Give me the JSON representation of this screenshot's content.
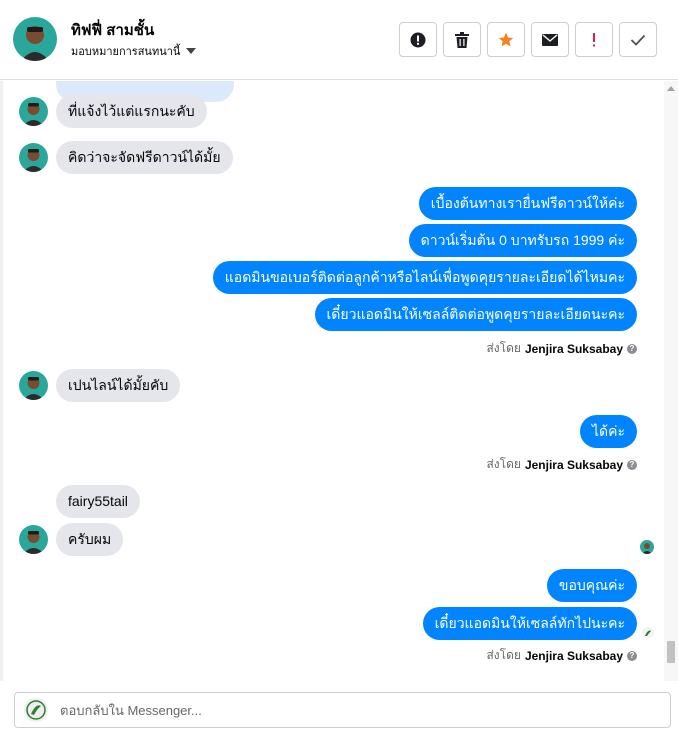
{
  "header": {
    "contact_name": "ทิฟฟี่ สามชั้น",
    "assign_label": "มอบหมายการสนทนานี้",
    "actions": [
      {
        "name": "report-spam-button",
        "icon": "exclamation-circle-icon"
      },
      {
        "name": "delete-button",
        "icon": "trash-icon"
      },
      {
        "name": "star-button",
        "icon": "star-icon"
      },
      {
        "name": "mark-unread-button",
        "icon": "envelope-icon"
      },
      {
        "name": "follow-up-button",
        "icon": "exclamation-icon"
      },
      {
        "name": "done-button",
        "icon": "check-icon"
      }
    ]
  },
  "colors": {
    "outgoing_bubble": "#0084ff",
    "incoming_bubble": "#e4e6eb",
    "star": "#f5821f",
    "follow_up": "#e41e3f"
  },
  "messages": {
    "in_1": "ที่แจ้งไว้แต่แรกนะคับ",
    "in_2": "คิดว่าจะจัดฟรีดาวน์ได้มั้ย",
    "out_1": "เบื้องต้นทางเรายื่นฟรีดาวน์ให้ค่ะ",
    "out_2": "ดาวน์เริ่มต้น 0 บาทรับรถ 1999 ค่ะ",
    "out_3": "แอดมินขอเบอร์ติดต่อลูกค้าหรือไลน์เพื่อพูดคุยรายละเอียดได้ไหมคะ",
    "out_4": "เดี๋ยวแอดมินให้เซลล์ติดต่อพูดคุยรายละเอียดนะคะ",
    "in_3": "เปนไลน์ได้มั้ยคับ",
    "out_5": "ได้ค่ะ",
    "in_4": "fairy55tail",
    "in_5": "ครับผม",
    "out_6": "ขอบคุณค่ะ",
    "out_7": "เดี๋ยวแอดมินให้เซลล์ทักไปนะคะ"
  },
  "sent_by": {
    "prefix": "ส่งโดย",
    "agent": "Jenjira Suksabay",
    "help": "?"
  },
  "composer": {
    "placeholder": "ตอบกลับใน Messenger..."
  }
}
